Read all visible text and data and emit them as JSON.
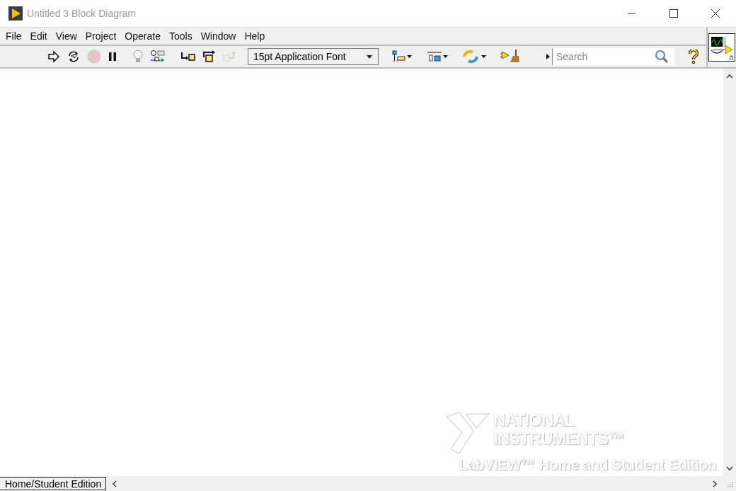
{
  "window": {
    "title": "Untitled 3 Block Diagram"
  },
  "menu": [
    "File",
    "Edit",
    "View",
    "Project",
    "Operate",
    "Tools",
    "Window",
    "Help"
  ],
  "toolbar": {
    "tools": [
      {
        "kind": "run",
        "disabled": false
      },
      {
        "kind": "run-continuously",
        "disabled": false
      },
      {
        "kind": "abort",
        "disabled": true
      },
      {
        "kind": "pause",
        "disabled": false
      },
      {
        "kind": "highlight",
        "disabled": false
      },
      {
        "kind": "retain",
        "disabled": false
      },
      {
        "kind": "step-into",
        "disabled": false
      },
      {
        "kind": "step-over",
        "disabled": false
      },
      {
        "kind": "step-out",
        "disabled": true
      }
    ],
    "font": {
      "value": "15pt Application Font"
    },
    "search": {
      "placeholder": "Search"
    }
  },
  "background_logo": {
    "line_1": "NATIONAL",
    "line_2": "INSTRUMENTS™",
    "line_3": "LabVIEW™ Home and Student Edition"
  },
  "status_bar": {
    "label": "Home/Student Edition"
  }
}
